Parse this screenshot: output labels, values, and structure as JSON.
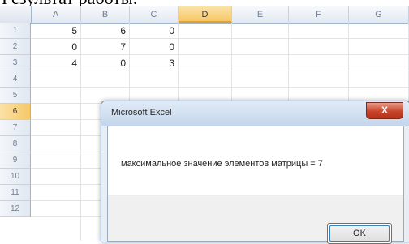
{
  "caption": "Результат работы:",
  "sheet": {
    "columns": [
      "A",
      "B",
      "C",
      "D",
      "E",
      "F",
      "G"
    ],
    "active_column": "D",
    "rows": [
      "1",
      "2",
      "3",
      "4",
      "5",
      "6",
      "7",
      "8",
      "9",
      "10",
      "11",
      "12"
    ],
    "active_row": "6",
    "cells": [
      [
        "5",
        "6",
        "0"
      ],
      [
        "0",
        "7",
        "0"
      ],
      [
        "4",
        "0",
        "3"
      ]
    ]
  },
  "dialog": {
    "title": "Microsoft Excel",
    "close_label": "X",
    "message": "максимальное значение элементов матрицы = 7",
    "ok_label": "OK"
  }
}
